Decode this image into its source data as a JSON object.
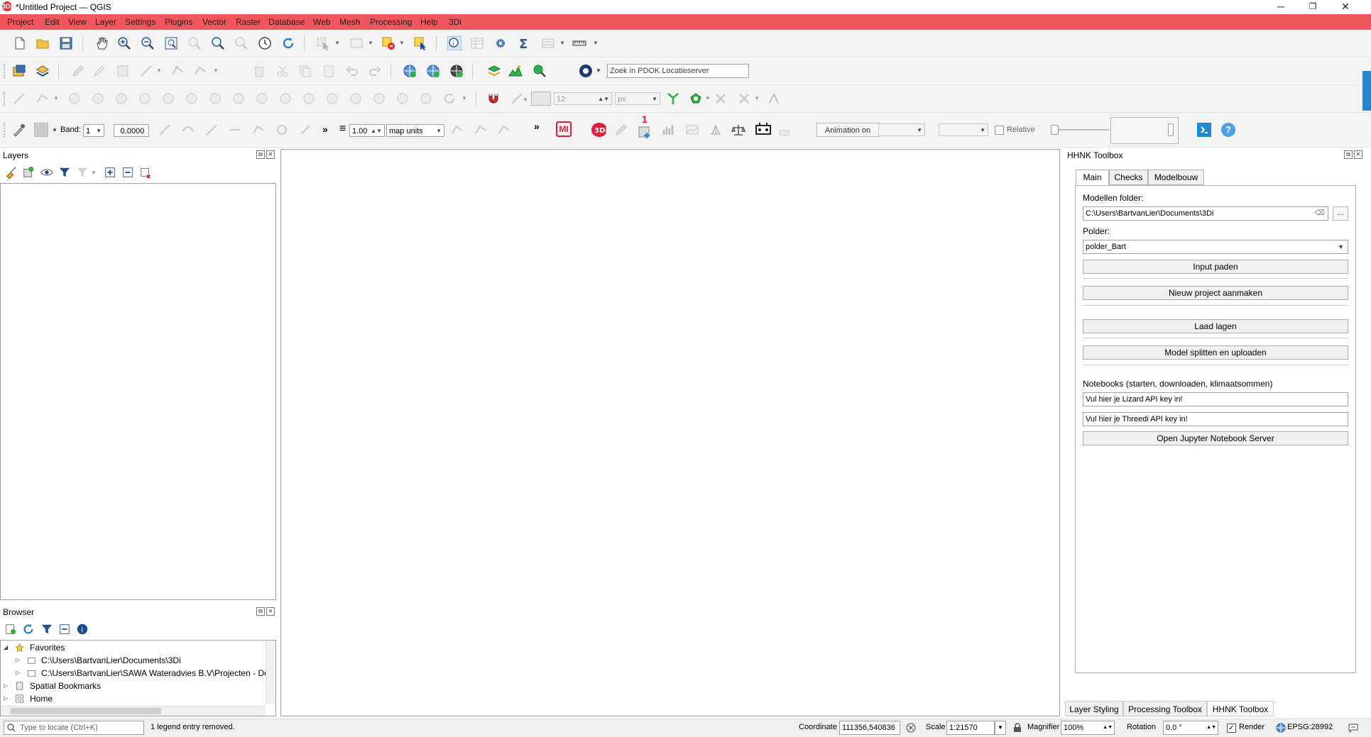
{
  "window": {
    "title": "*Untitled Project — QGIS",
    "minimize": "─",
    "maximize": "❐",
    "close": "✕",
    "app_icon_text": "3Di"
  },
  "menu": [
    "Project",
    "Edit",
    "View",
    "Layer",
    "Settings",
    "Plugins",
    "Vector",
    "Raster",
    "Database",
    "Web",
    "Mesh",
    "Processing",
    "Help",
    "3Di"
  ],
  "toolbar2": {
    "search_placeholder": "Zoek in PDOK Locatieserver"
  },
  "toolbar3": {
    "size_value": "12",
    "unit": "px"
  },
  "toolbar4": {
    "band_label": "Band:",
    "band_value": "1",
    "band_offset": "0.0000",
    "more": "»",
    "line_width": "1.00",
    "line_units": "map units",
    "badge_number": "1",
    "mi_label": "MI",
    "animation_label": "Animation on",
    "relative_label": "Relative",
    "help_icon_text": "?"
  },
  "layers_panel": {
    "title": "Layers"
  },
  "browser_panel": {
    "title": "Browser",
    "items": [
      {
        "label": "Favorites",
        "level": 0,
        "expanded": true,
        "icon": "star-icon"
      },
      {
        "label": "C:\\Users\\BartvanLier\\Documents\\3Di",
        "level": 1,
        "expanded": false,
        "icon": "folder-icon"
      },
      {
        "label": "C:\\Users\\BartvanLier\\SAWA Wateradvies B.V\\Projecten - Doc",
        "level": 1,
        "expanded": false,
        "icon": "folder-icon"
      },
      {
        "label": "Spatial Bookmarks",
        "level": 0,
        "expanded": false,
        "icon": "bookmark-icon"
      },
      {
        "label": "Home",
        "level": 0,
        "expanded": false,
        "icon": "home-icon"
      }
    ]
  },
  "hhnk": {
    "title": "HHNK Toolbox",
    "tabs": [
      "Main",
      "Checks",
      "Modelbouw"
    ],
    "active_tab": "Main",
    "modellen_label": "Modellen folder:",
    "modellen_value": "C:\\Users\\BartvanLier\\Documents\\3Di",
    "browse_label": "...",
    "polder_label": "Polder:",
    "polder_value": "polder_Bart",
    "buttons": {
      "input_paden": "Input paden",
      "nieuw_project": "Nieuw project aanmaken",
      "laad_lagen": "Laad lagen",
      "model_splitten": "Model splitten en uploaden",
      "open_jupyter": "Open Jupyter Notebook Server"
    },
    "notebooks_label": "Notebooks (starten, downloaden, klimaatsommen)",
    "lizard_key": "Vul hier je Lizard API key in!",
    "threedi_key": "Vul hier je Threedi API key in!"
  },
  "bottom_tabs": [
    "Layer Styling",
    "Processing Toolbox",
    "HHNK Toolbox"
  ],
  "bottom_active": "HHNK Toolbox",
  "status": {
    "locate_placeholder": "Type to locate (Ctrl+K)",
    "message": "1 legend entry removed.",
    "coordinate_label": "Coordinate",
    "coordinate_value": "111356,540836",
    "scale_label": "Scale",
    "scale_value": "1:21570",
    "magnifier_label": "Magnifier",
    "magnifier_value": "100%",
    "rotation_label": "Rotation",
    "rotation_value": "0.0 °",
    "render_label": "Render",
    "crs": "EPSG:28992"
  },
  "colors": {
    "menubar": "#f1575f",
    "accent_blue": "#1e8ad6",
    "threedi_red": "#e31b3b"
  }
}
